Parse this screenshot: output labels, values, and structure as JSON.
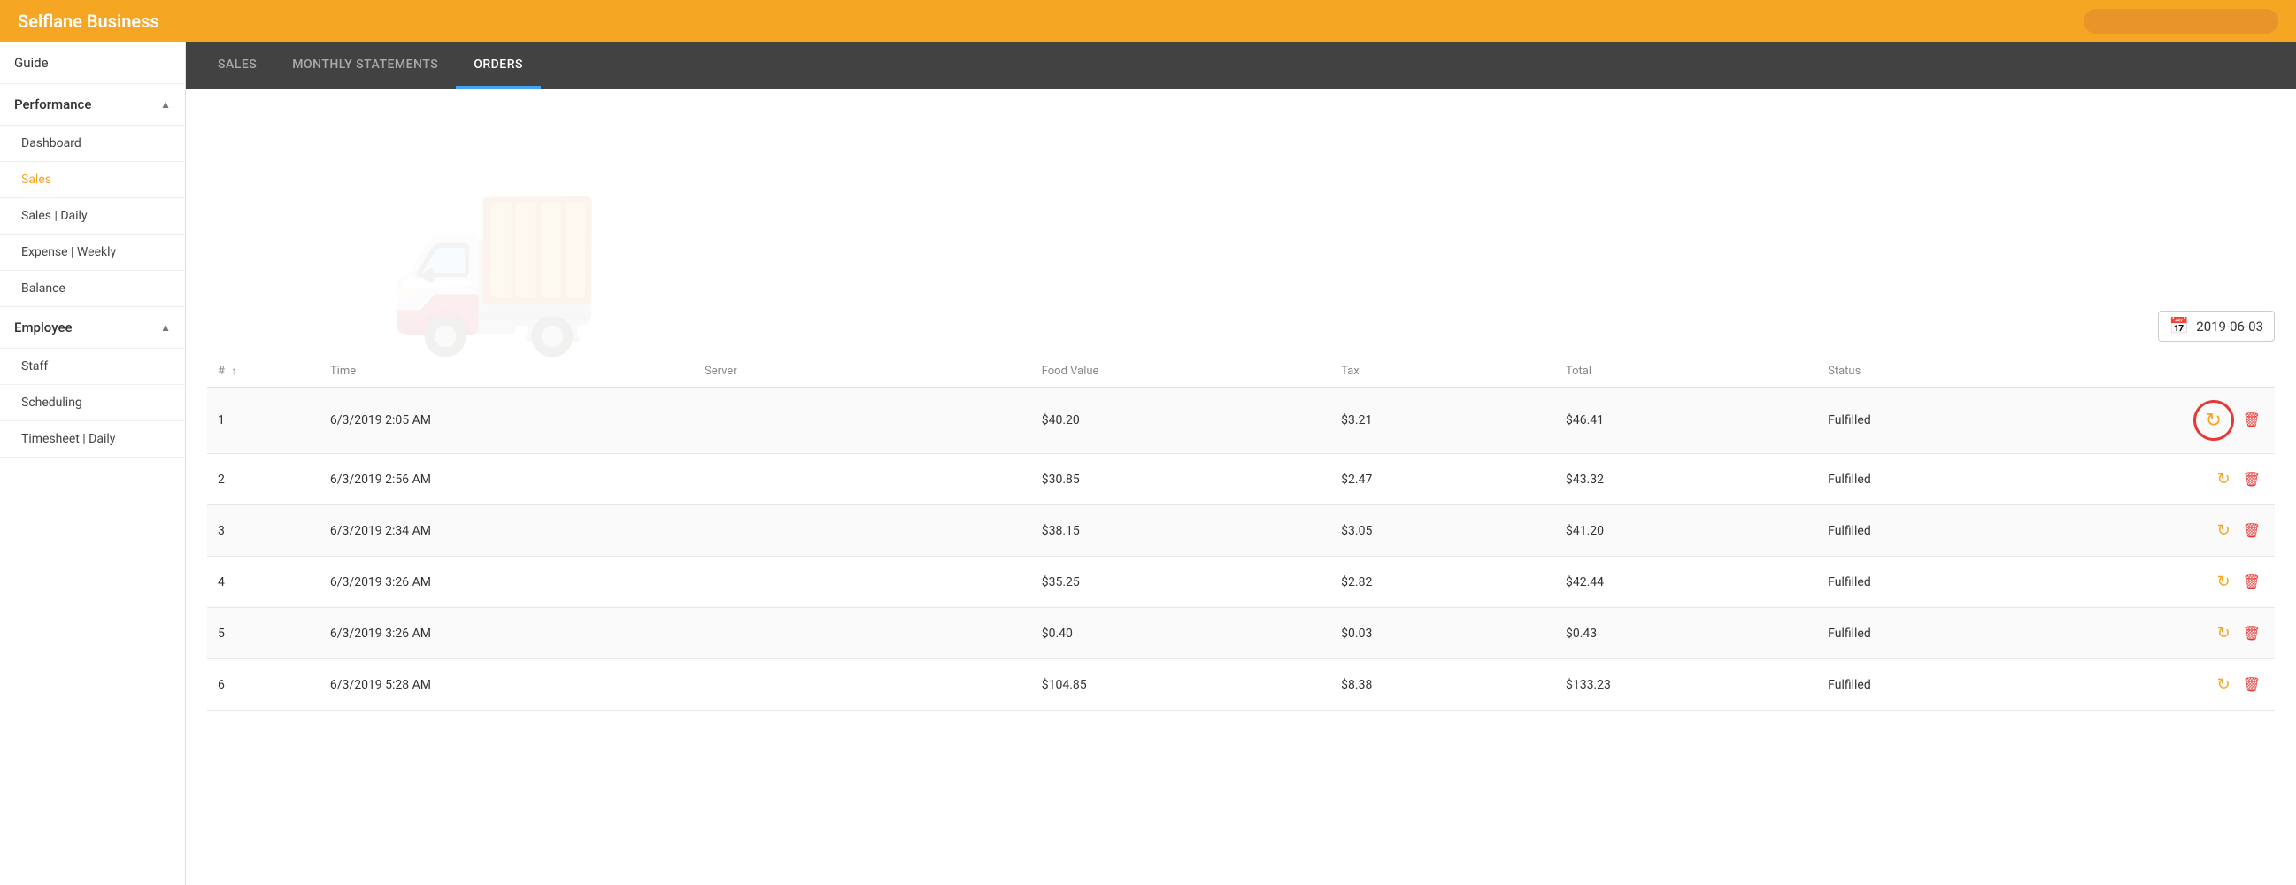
{
  "header": {
    "title": "Selflane Business"
  },
  "sidebar": {
    "items": [
      {
        "id": "guide",
        "label": "Guide",
        "level": "top",
        "active": false
      },
      {
        "id": "performance",
        "label": "Performance",
        "level": "section",
        "expanded": true
      },
      {
        "id": "dashboard",
        "label": "Dashboard",
        "level": "sub",
        "active": false
      },
      {
        "id": "sales",
        "label": "Sales",
        "level": "sub",
        "active": true
      },
      {
        "id": "sales-daily",
        "label": "Sales | Daily",
        "level": "sub",
        "active": false
      },
      {
        "id": "expense-weekly",
        "label": "Expense | Weekly",
        "level": "sub",
        "active": false
      },
      {
        "id": "balance",
        "label": "Balance",
        "level": "sub",
        "active": false
      },
      {
        "id": "employee",
        "label": "Employee",
        "level": "section",
        "expanded": true
      },
      {
        "id": "staff",
        "label": "Staff",
        "level": "sub",
        "active": false
      },
      {
        "id": "scheduling",
        "label": "Scheduling",
        "level": "sub",
        "active": false
      },
      {
        "id": "timesheet-daily",
        "label": "Timesheet | Daily",
        "level": "sub",
        "active": false
      }
    ]
  },
  "tabs": [
    {
      "id": "sales",
      "label": "SALES",
      "active": false
    },
    {
      "id": "monthly-statements",
      "label": "MONTHLY STATEMENTS",
      "active": false
    },
    {
      "id": "orders",
      "label": "ORDERS",
      "active": true
    }
  ],
  "date_picker": {
    "value": "2019-06-03",
    "icon": "📅"
  },
  "table": {
    "columns": [
      {
        "id": "num",
        "label": "#",
        "sortable": true
      },
      {
        "id": "time",
        "label": "Time"
      },
      {
        "id": "server",
        "label": "Server"
      },
      {
        "id": "food_value",
        "label": "Food Value"
      },
      {
        "id": "tax",
        "label": "Tax"
      },
      {
        "id": "total",
        "label": "Total"
      },
      {
        "id": "status",
        "label": "Status"
      }
    ],
    "rows": [
      {
        "num": "1",
        "time": "6/3/2019 2:05 AM",
        "server": "",
        "food_value": "$40.20",
        "tax": "$3.21",
        "total": "$46.41",
        "status": "Fulfilled",
        "highlighted": true
      },
      {
        "num": "2",
        "time": "6/3/2019 2:56 AM",
        "server": "",
        "food_value": "$30.85",
        "tax": "$2.47",
        "total": "$43.32",
        "status": "Fulfilled",
        "highlighted": false
      },
      {
        "num": "3",
        "time": "6/3/2019 2:34 AM",
        "server": "",
        "food_value": "$38.15",
        "tax": "$3.05",
        "total": "$41.20",
        "status": "Fulfilled",
        "highlighted": false
      },
      {
        "num": "4",
        "time": "6/3/2019 3:26 AM",
        "server": "",
        "food_value": "$35.25",
        "tax": "$2.82",
        "total": "$42.44",
        "status": "Fulfilled",
        "highlighted": false
      },
      {
        "num": "5",
        "time": "6/3/2019 3:26 AM",
        "server": "",
        "food_value": "$0.40",
        "tax": "$0.03",
        "total": "$0.43",
        "status": "Fulfilled",
        "highlighted": false
      },
      {
        "num": "6",
        "time": "6/3/2019 5:28 AM",
        "server": "",
        "food_value": "$104.85",
        "tax": "$8.38",
        "total": "$133.23",
        "status": "Fulfilled",
        "highlighted": false
      }
    ]
  }
}
